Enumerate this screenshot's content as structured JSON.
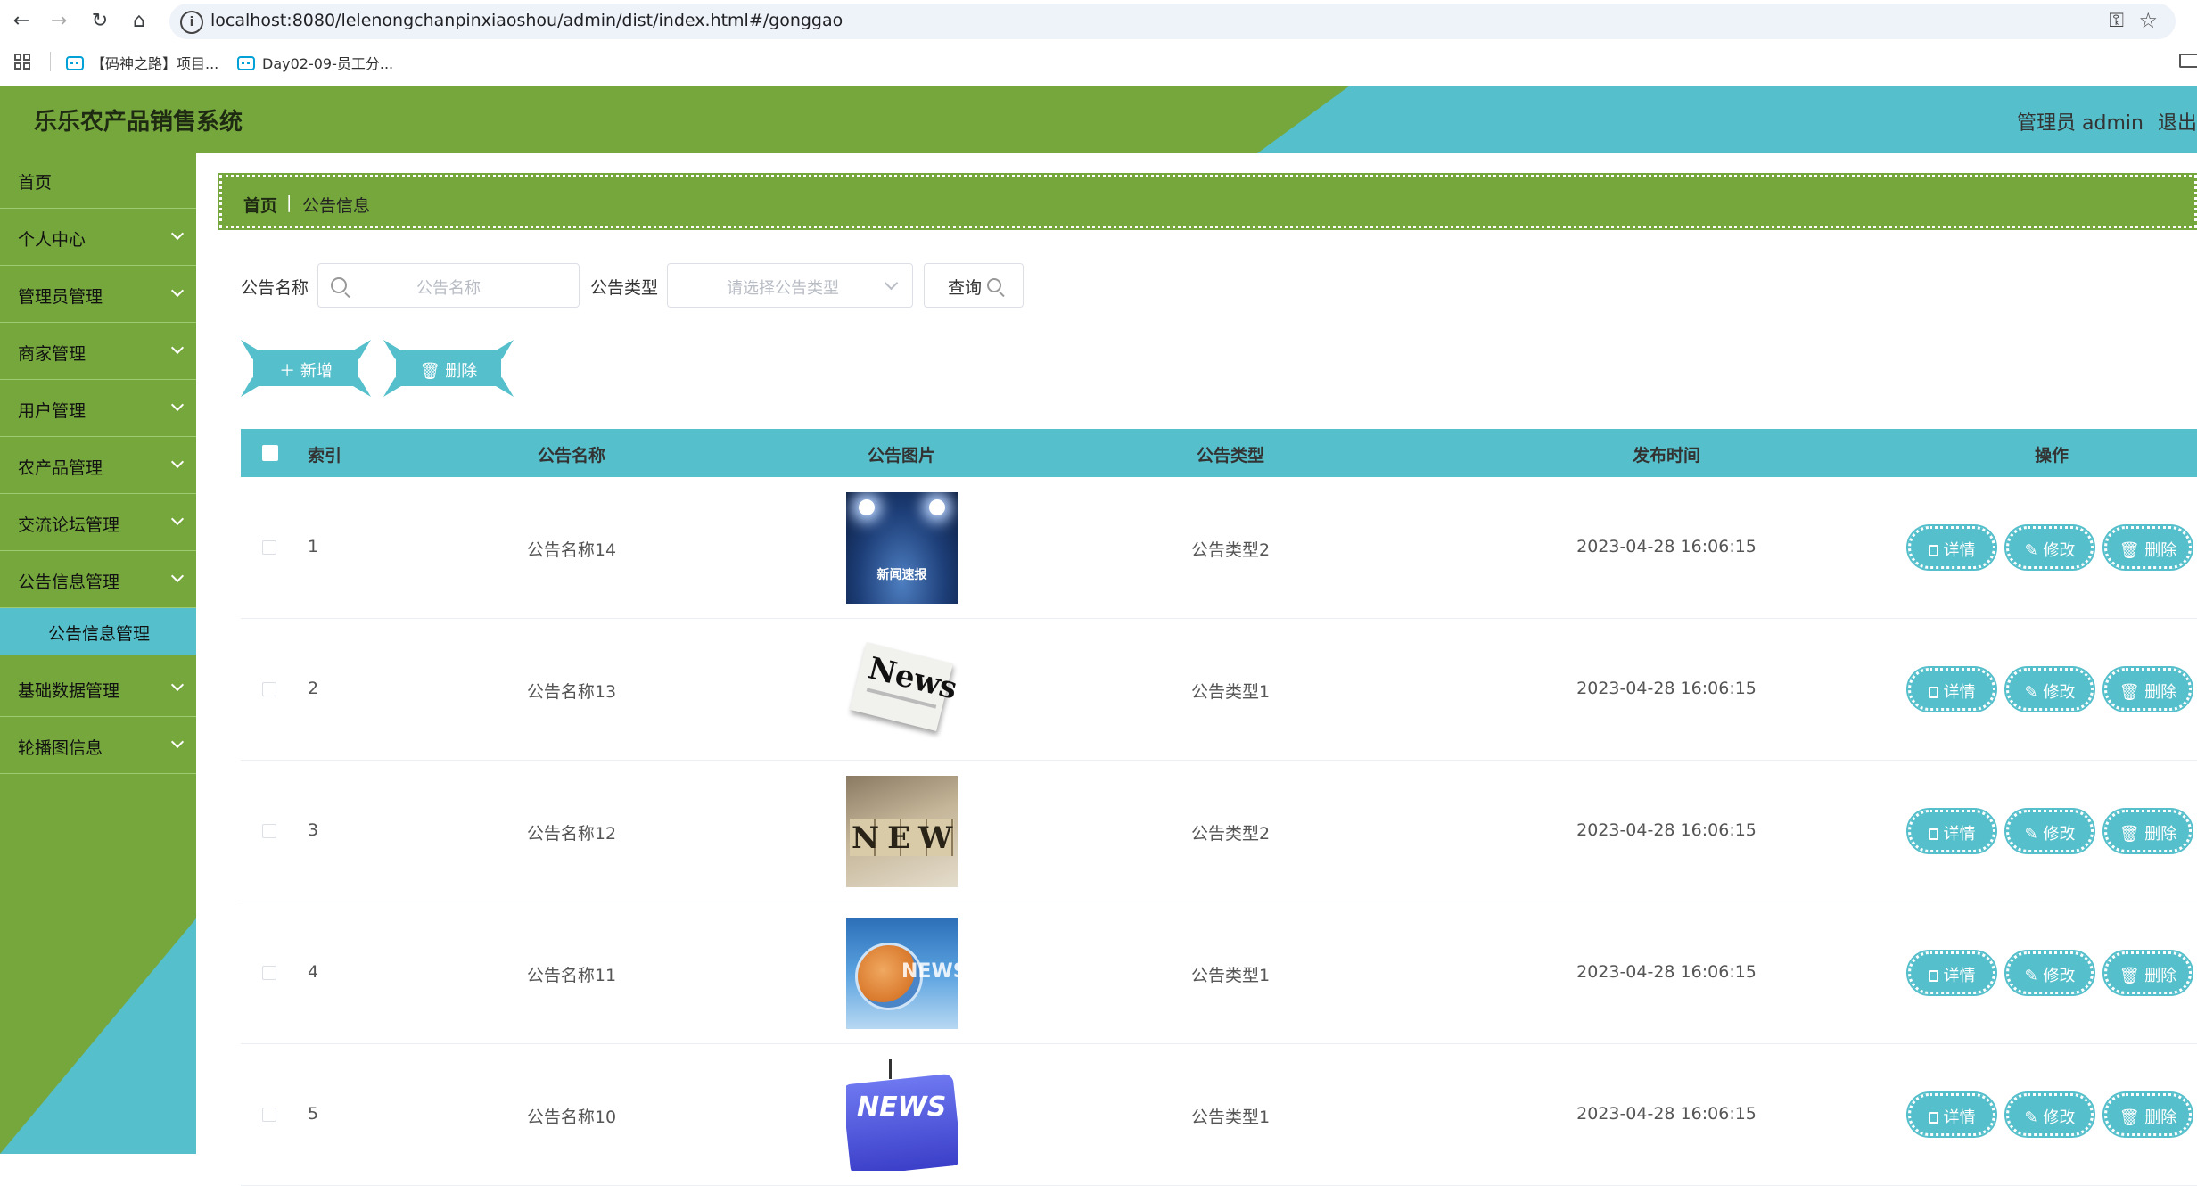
{
  "browser": {
    "url": "localhost:8080/lelenongchanpinxiaoshou/admin/dist/index.html#/gonggao",
    "bookmarks": [
      "【码神之路】项目...",
      "Day02-09-员工分..."
    ]
  },
  "header": {
    "title": "乐乐农产品销售系统",
    "admin": "管理员 admin",
    "logout": "退出登录"
  },
  "sidebar": {
    "items": [
      {
        "label": "首页",
        "chevron": false
      },
      {
        "label": "个人中心",
        "chevron": true
      },
      {
        "label": "管理员管理",
        "chevron": true
      },
      {
        "label": "商家管理",
        "chevron": true
      },
      {
        "label": "用户管理",
        "chevron": true
      },
      {
        "label": "农产品管理",
        "chevron": true
      },
      {
        "label": "交流论坛管理",
        "chevron": true
      },
      {
        "label": "公告信息管理",
        "chevron": true
      }
    ],
    "sub_item": "公告信息管理",
    "after_items": [
      {
        "label": "基础数据管理"
      },
      {
        "label": "轮播图信息"
      }
    ]
  },
  "breadcrumb": {
    "home": "首页",
    "separator": "|",
    "current": "公告信息"
  },
  "search": {
    "name_label": "公告名称",
    "name_placeholder": "公告名称",
    "type_label": "公告类型",
    "type_placeholder": "请选择公告类型",
    "query_button": "查询"
  },
  "actions": {
    "add": "新增",
    "delete": "删除"
  },
  "table": {
    "columns": [
      "索引",
      "公告名称",
      "公告图片",
      "公告类型",
      "发布时间",
      "操作"
    ],
    "rows": [
      {
        "index": "1",
        "name": "公告名称14",
        "image": "spotlight-stage-news",
        "image_text": "新闻速报",
        "type": "公告类型2",
        "time": "2023-04-28 16:06:15"
      },
      {
        "index": "2",
        "name": "公告名称13",
        "image": "newspaper-news",
        "image_text": "News",
        "type": "公告类型1",
        "time": "2023-04-28 16:06:15"
      },
      {
        "index": "3",
        "name": "公告名称12",
        "image": "wooden-blocks-news",
        "image_text": "NEWS",
        "type": "公告类型2",
        "time": "2023-04-28 16:06:15"
      },
      {
        "index": "4",
        "name": "公告名称11",
        "image": "blue-globe-news",
        "image_text": "NEWS",
        "type": "公告类型1",
        "time": "2023-04-28 16:06:15"
      },
      {
        "index": "5",
        "name": "公告名称10",
        "image": "blue-key-news",
        "image_text": "NEWS",
        "type": "公告类型1",
        "time": "2023-04-28 16:06:15"
      }
    ],
    "row_actions": {
      "detail": "详情",
      "edit": "修改",
      "delete": "删除"
    }
  },
  "colors": {
    "green": "#75a73d",
    "teal": "#55bfcb"
  }
}
